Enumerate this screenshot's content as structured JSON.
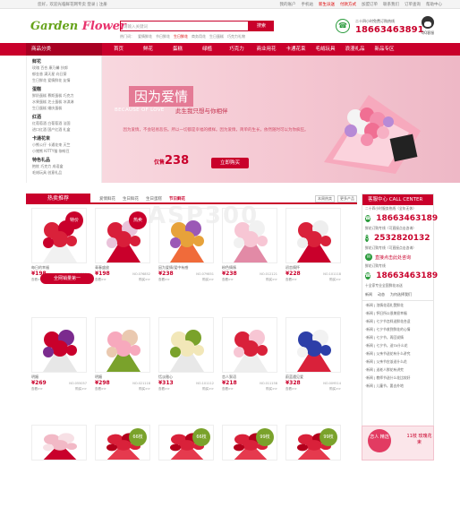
{
  "topbar": {
    "left": "您好，欢迎光临鲜花网专卖 登录 | 注册",
    "right": [
      "我的账户",
      "手机站",
      "新生派送",
      "付款方式",
      "加盟订单",
      "联系我们",
      "订单查询",
      "帮助中心"
    ]
  },
  "logo": {
    "prefix": "Gar",
    "mid": "den",
    "suffix": "Flower"
  },
  "search": {
    "placeholder": "请输入关键词",
    "button": "搜索"
  },
  "hotwords": {
    "label": "热门词：",
    "items": [
      "爱情鲜花",
      "节日鲜花",
      "生日鲜花",
      "商务用花",
      "生日蛋糕",
      "巧克力礼物"
    ]
  },
  "phone": {
    "hours": "二十四小时免费订购热线",
    "number": "18663463891"
  },
  "qq": {
    "label": "QQ客服"
  },
  "nav": {
    "category_label": "商品分类",
    "items": [
      "首页",
      "鲜花",
      "蛋糕",
      "绿植",
      "巧克力",
      "商业用花",
      "卡通花束",
      "毛绒玩具",
      "浪漫礼品",
      "新品专区"
    ]
  },
  "sidebar": [
    {
      "title": "鲜花",
      "rows": [
        "玫瑰 百合 康乃馨 扶郎",
        "郁金香 满天星 向日葵",
        "生日鲜花 爱情鲜花 友情"
      ]
    },
    {
      "title": "蛋糕",
      "rows": [
        "鲜奶蛋糕 慕斯蛋糕 巧克力",
        "水果蛋糕 芝士蛋糕 冰淇淋",
        "生日蛋糕 婚庆蛋糕"
      ]
    },
    {
      "title": "红酒",
      "rows": [
        "红葡萄酒 白葡萄酒 法国",
        "进口红酒 国产红酒 礼盒"
      ]
    },
    {
      "title": "卡通花束",
      "rows": [
        "小熊公仔 卡通花束 天竺",
        "小猪熊 KITTY猫 咖啡豆"
      ]
    },
    {
      "title": "特色礼品",
      "rows": [
        "抱枕 巧克力 成语盒",
        "毛绒玩具 创意礼品"
      ]
    }
  ],
  "banner": {
    "headline": "因为爱情",
    "english": "BECAUSE OF LOVE",
    "subline": "此生我只想与你相伴",
    "desc": "因为爱情，不会轻易悲伤。所以一切都是幸福的模样。因为爱情，简单的生长，依然随时可以为你疯狂。",
    "price": "238",
    "price_prefix": "仅售",
    "buy_button": "立即购买"
  },
  "hot": {
    "title": "热卖推荐",
    "tabs": [
      "爱情鲜花",
      "生日鲜花",
      "生日蛋糕",
      "节日鲜花"
    ],
    "active_tab": "节日鲜花",
    "controls": [
      "本周热卖",
      "更多产品"
    ]
  },
  "products": [
    {
      "name": "每日的幸福",
      "price": "¥198",
      "no": "NO.079800",
      "tag": "特价",
      "ops": [
        "查看>>",
        "购买>>"
      ]
    },
    {
      "name": "青春盛放",
      "price": "¥198",
      "no": "NO.076852",
      "tag": "热卖",
      "ops": [
        "查看>>",
        "购买>>"
      ]
    },
    {
      "name": "因为爱情/爱中有感",
      "price": "¥238",
      "no": "NO.079851",
      "tag": "",
      "ops": [
        "查看>>",
        "购买>>"
      ]
    },
    {
      "name": "粉色情愫",
      "price": "¥238",
      "no": "NO.012121",
      "tag": "",
      "ops": [
        "查看>>",
        "购买>>"
      ]
    },
    {
      "name": "初恋情怀",
      "price": "¥228",
      "no": "NO.101118",
      "tag": "",
      "ops": [
        "查看>>",
        "购买>>"
      ]
    },
    {
      "name": "明媚",
      "price": "¥269",
      "no": "NO.055057",
      "tag": "",
      "ops": [
        "查看>>",
        "购买>>"
      ]
    },
    {
      "name": "明媚",
      "price": "¥298",
      "no": "NO.021118",
      "tag": "",
      "ops": [
        "查看>>",
        "购买>>"
      ]
    },
    {
      "name": "恬淡雅心",
      "price": "¥313",
      "no": "NO.101112",
      "tag": "",
      "ops": [
        "查看>>",
        "购买>>"
      ]
    },
    {
      "name": "恋人絮语",
      "price": "¥218",
      "no": "NO.011158",
      "tag": "",
      "ops": [
        "查看>>",
        "购买>>"
      ]
    },
    {
      "name": "蔚蓝遇见爱",
      "price": "¥328",
      "no": "NO.009514",
      "tag": "",
      "ops": [
        "查看>>",
        "购买>>"
      ]
    },
    {
      "name": "",
      "price": "",
      "no": "",
      "tag": "",
      "ops": []
    },
    {
      "name": "",
      "price": "",
      "no": "",
      "tag": "66枝",
      "ops": []
    },
    {
      "name": "",
      "price": "",
      "no": "",
      "tag": "66枝",
      "ops": []
    },
    {
      "name": "",
      "price": "",
      "no": "",
      "tag": "99枝",
      "ops": []
    },
    {
      "name": "",
      "price": "",
      "no": "",
      "tag": "99枝",
      "ops": []
    }
  ],
  "promo": "全网销量第一",
  "service": {
    "title": "客服中心 CALL CENTER",
    "lines": [
      "二十四小时服务热线（全年无休）",
      "18663463189",
      "鲜花订购专线（可直接点击咨询）",
      "2532820132",
      "鲜花订购专线（可直接点击咨询）",
      "直接点击此处咨询",
      "鲜花订购专线",
      "18663463189",
      "十全家专业全国鲜花派送"
    ],
    "tabs": [
      "新闻",
      "动态",
      "为何选择我们"
    ],
    "news": [
      "·新闻 | 浓情花语礼赞鲜花",
      "·新闻 | 怀旧所以很美很幸福",
      "·新闻 | 七夕节怎样送鲜花合适",
      "·新闻 | 七夕节收到鲜花的心情",
      "·新闻 | 七夕节，再回说情",
      "·新闻 | 七夕节，送TA什么花",
      "·新闻 | 父亲节送花有什么讲究",
      "·新闻 | 父亲节应该送什么花",
      "·新闻 | 送老人鲜花有讲究",
      "·新闻 | 教师节送什么花比较好",
      "·新闻 | 儿童节，要去外地"
    ]
  },
  "ad": {
    "circle": "恋人 精选",
    "text": "11枝 玫瑰花束"
  },
  "colors": {
    "brand": "#c9002b",
    "banner": "#f3c9d3"
  }
}
